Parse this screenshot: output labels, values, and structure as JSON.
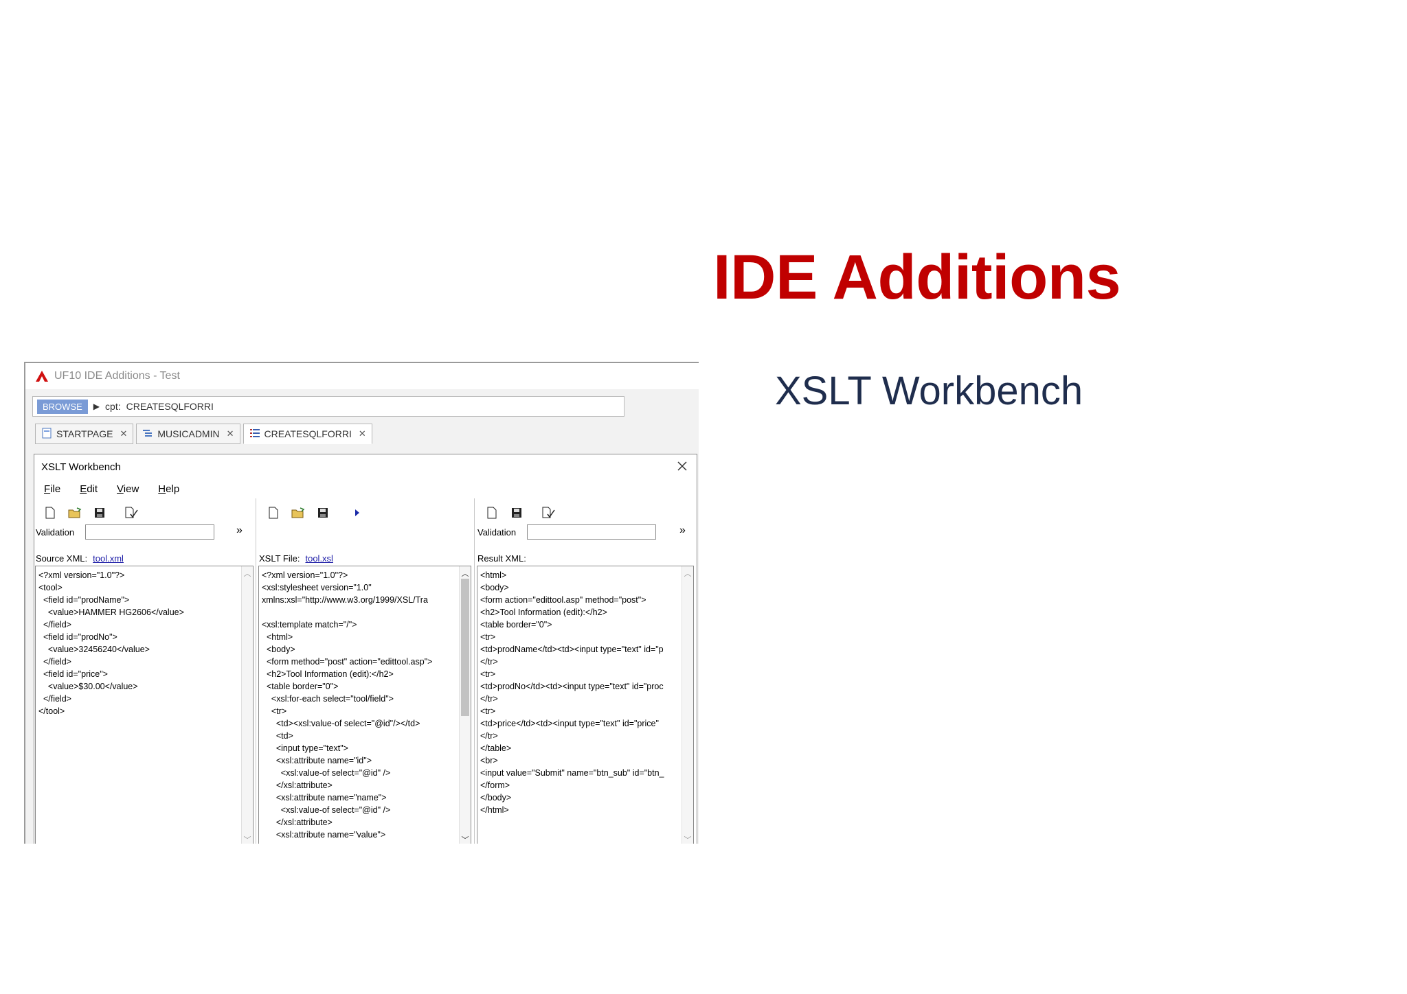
{
  "slide": {
    "title": "IDE Additions",
    "subtitle": "XSLT Workbench"
  },
  "app": {
    "title": "UF10 IDE Additions - Test",
    "breadcrumb": {
      "browse": "BROWSE",
      "prefix": "cpt:",
      "value": "CREATESQLFORRI"
    },
    "tabs": [
      {
        "label": "STARTPAGE",
        "icon": "page-icon"
      },
      {
        "label": "MUSICADMIN",
        "icon": "tree-icon"
      },
      {
        "label": "CREATESQLFORRI",
        "icon": "list-icon"
      }
    ]
  },
  "workbench": {
    "title": "XSLT Workbench",
    "menu": [
      "File",
      "Edit",
      "View",
      "Help"
    ],
    "source": {
      "validation_label": "Validation",
      "file_label": "Source XML:",
      "file_name": "tool.xml",
      "code": "<?xml version=\"1.0\"?>\n<tool>\n  <field id=\"prodName\">\n    <value>HAMMER HG2606</value>\n  </field>\n  <field id=\"prodNo\">\n    <value>32456240</value>\n  </field>\n  <field id=\"price\">\n    <value>$30.00</value>\n  </field>\n</tool>"
    },
    "xslt": {
      "file_label": "XSLT File:",
      "file_name": "tool.xsl",
      "code": "<?xml version=\"1.0\"?>\n<xsl:stylesheet version=\"1.0\"\nxmlns:xsl=\"http://www.w3.org/1999/XSL/Tra\n\n<xsl:template match=\"/\">\n  <html>\n  <body>\n  <form method=\"post\" action=\"edittool.asp\">\n  <h2>Tool Information (edit):</h2>\n  <table border=\"0\">\n    <xsl:for-each select=\"tool/field\">\n    <tr>\n      <td><xsl:value-of select=\"@id\"/></td>\n      <td>\n      <input type=\"text\">\n      <xsl:attribute name=\"id\">\n        <xsl:value-of select=\"@id\" />\n      </xsl:attribute>\n      <xsl:attribute name=\"name\">\n        <xsl:value-of select=\"@id\" />\n      </xsl:attribute>\n      <xsl:attribute name=\"value\">"
    },
    "result": {
      "validation_label": "Validation",
      "file_label": "Result XML:",
      "code": "<html>\n<body>\n<form action=\"edittool.asp\" method=\"post\">\n<h2>Tool Information (edit):</h2>\n<table border=\"0\">\n<tr>\n<td>prodName</td><td><input type=\"text\" id=\"p\n</tr>\n<tr>\n<td>prodNo</td><td><input type=\"text\" id=\"proc\n</tr>\n<tr>\n<td>price</td><td><input type=\"text\" id=\"price\"\n</tr>\n</table>\n<br>\n<input value=\"Submit\" name=\"btn_sub\" id=\"btn_\n</form>\n</body>\n</html>"
    }
  }
}
